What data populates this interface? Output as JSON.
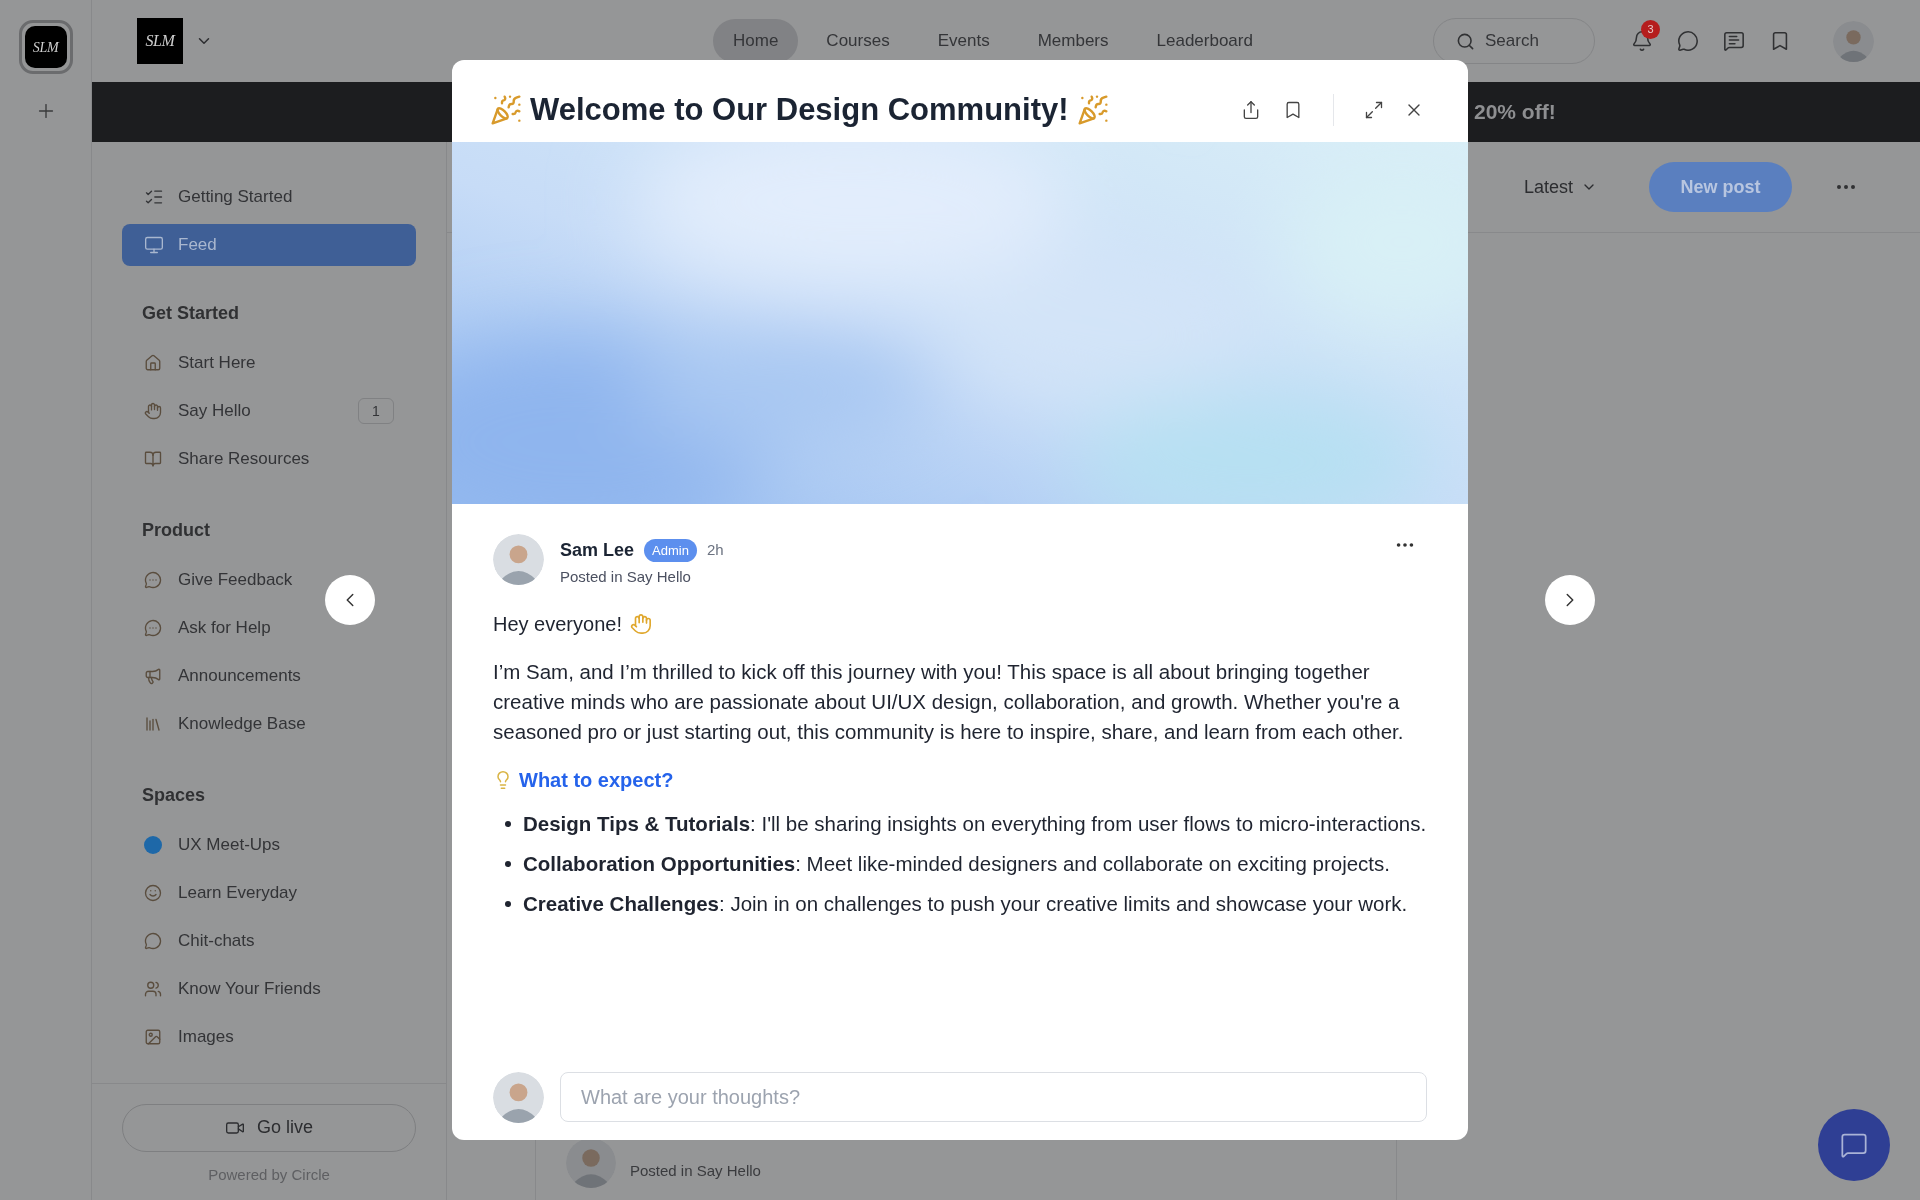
{
  "rail": {
    "logo": "SLM"
  },
  "header": {
    "logo": "SLM",
    "nav": [
      {
        "label": "Home",
        "selected": true
      },
      {
        "label": "Courses",
        "selected": false
      },
      {
        "label": "Events",
        "selected": false
      },
      {
        "label": "Members",
        "selected": false
      },
      {
        "label": "Leaderboard",
        "selected": false
      }
    ],
    "search": {
      "placeholder": "Search"
    },
    "notification_count": "3"
  },
  "banner": {
    "text": "20% off!"
  },
  "sidebar": {
    "top_items": [
      {
        "label": "Getting Started",
        "selected": false
      },
      {
        "label": "Feed",
        "selected": true
      }
    ],
    "sections": [
      {
        "title": "Get Started",
        "items": [
          {
            "label": "Start Here"
          },
          {
            "label": "Say Hello",
            "count": "1"
          },
          {
            "label": "Share Resources"
          }
        ]
      },
      {
        "title": "Product",
        "items": [
          {
            "label": "Give Feedback"
          },
          {
            "label": "Ask for Help"
          },
          {
            "label": "Announcements"
          },
          {
            "label": "Knowledge Base"
          }
        ]
      },
      {
        "title": "Spaces",
        "items": [
          {
            "label": "UX Meet-Ups"
          },
          {
            "label": "Learn Everyday"
          },
          {
            "label": "Chit-chats"
          },
          {
            "label": "Know Your Friends"
          },
          {
            "label": "Images"
          }
        ]
      }
    ],
    "go_live": "Go live",
    "powered_by": "Powered by Circle"
  },
  "feed": {
    "sort": "Latest",
    "new_post": "New post",
    "peek_meta": "Posted in Say Hello"
  },
  "modal": {
    "title": "Welcome to Our Design Community!",
    "post": {
      "author": "Sam Lee",
      "badge": "Admin",
      "time": "2h",
      "posted_in": "Posted in Say Hello",
      "greeting": "Hey everyone!",
      "paragraph": "I’m Sam, and I’m thrilled to kick off this journey with you! This space is all about bringing together creative minds who are passionate about UI/UX design, collaboration, and growth. Whether you're a seasoned pro or just starting out, this community is here to inspire, share, and learn from each other.",
      "heading": "What to expect?",
      "bullets": [
        "**Design Tips & Tutorials**: I'll be sharing insights on everything from user flows to micro-interactions.",
        "**Collaboration Opportunities**: Meet like-minded designers and collaborate on exciting projects.",
        "**Creative Challenges**: Join in on challenges to push your creative limits and showcase your work."
      ]
    },
    "comment": {
      "placeholder": "What are your thoughts?"
    }
  }
}
